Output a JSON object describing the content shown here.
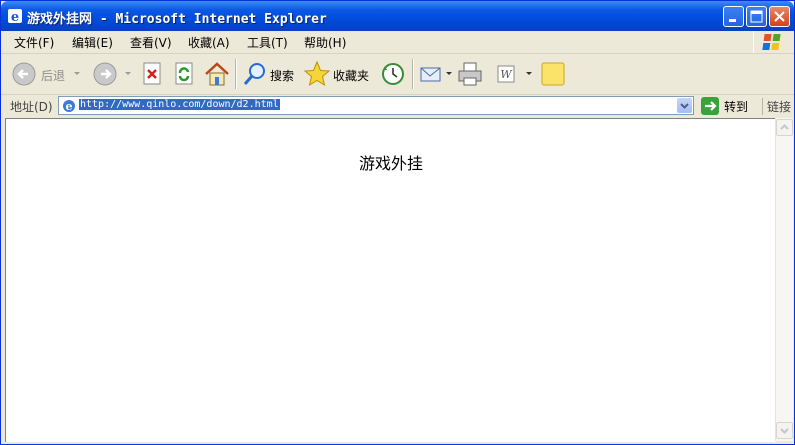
{
  "window": {
    "title": "游戏外挂网 - Microsoft Internet Explorer"
  },
  "menu": {
    "items": [
      "文件(F)",
      "编辑(E)",
      "查看(V)",
      "收藏(A)",
      "工具(T)",
      "帮助(H)"
    ]
  },
  "toolbar": {
    "back_label": "后退",
    "search_label": "搜索",
    "favorites_label": "收藏夹"
  },
  "address": {
    "label": "地址(D)",
    "url": "http://www.qinlo.com/down/d2.html",
    "go_label": "转到",
    "links_label": "链接"
  },
  "page": {
    "heading": "游戏外挂"
  },
  "colors": {
    "titlebar": "#0a58e5",
    "chrome": "#ece9d8",
    "selection": "#316ac5"
  }
}
